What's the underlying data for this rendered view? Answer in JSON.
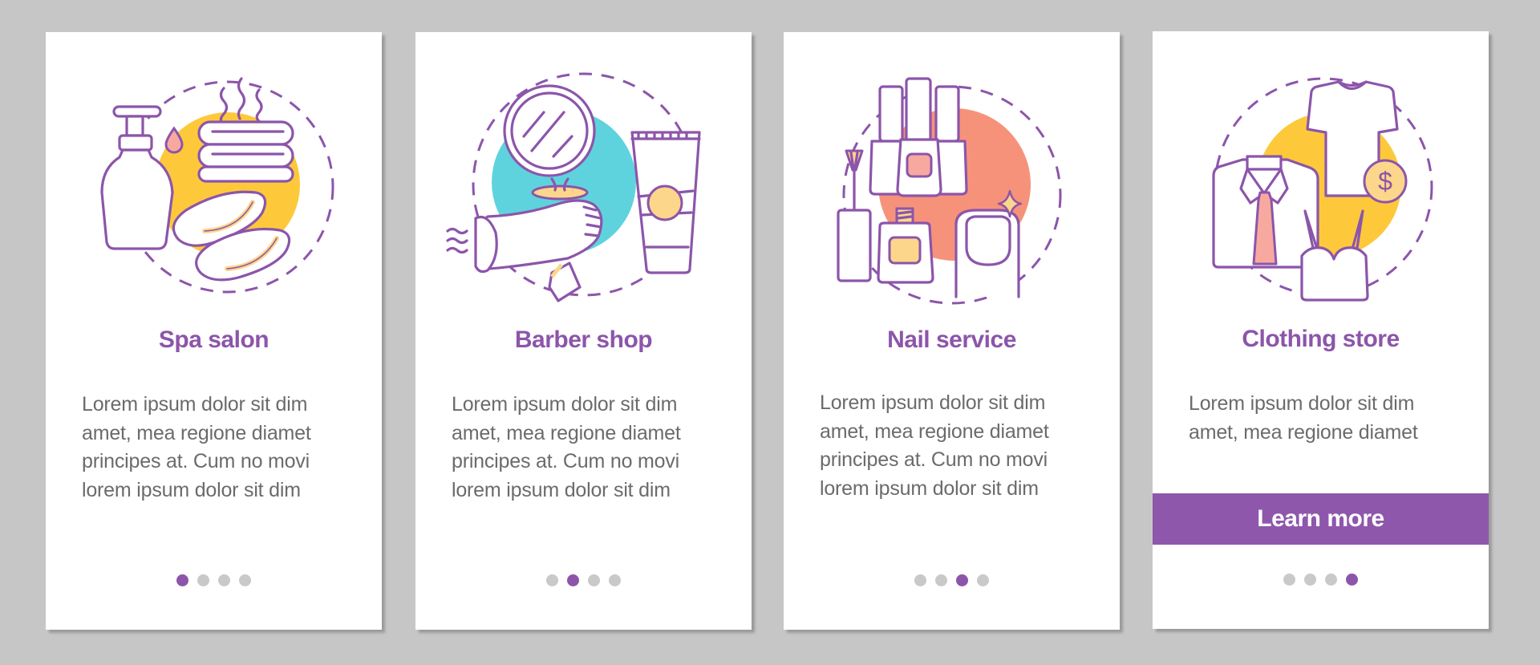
{
  "colors": {
    "accent": "#8c55aa",
    "button": "#8f57ac",
    "body_text": "#6b6b6b",
    "dot_inactive": "#c9c9c9",
    "background": "#c6c6c6",
    "yellow": "#fdc93b",
    "teal": "#5fd3dd",
    "salmon": "#f7927a",
    "light_orange": "#fcd68a",
    "pink": "#f7a9a0"
  },
  "cards": [
    {
      "title": "Spa salon",
      "icon": "spa-salon-illustration",
      "body": [
        "Lorem ipsum dolor sit dim",
        "amet, mea regione diamet",
        "principes at. Cum no movi",
        "lorem ipsum dolor sit dim"
      ],
      "page_indicator": {
        "total": 4,
        "active": 1
      }
    },
    {
      "title": "Barber shop",
      "icon": "barber-shop-illustration",
      "body": [
        "Lorem ipsum dolor sit dim",
        "amet, mea regione diamet",
        "principes at. Cum no movi",
        "lorem ipsum dolor sit dim"
      ],
      "page_indicator": {
        "total": 4,
        "active": 2
      }
    },
    {
      "title": "Nail service",
      "icon": "nail-service-illustration",
      "body": [
        "Lorem ipsum dolor sit dim",
        "amet, mea regione diamet",
        "principes at. Cum no movi",
        "lorem ipsum dolor sit dim"
      ],
      "page_indicator": {
        "total": 4,
        "active": 3
      }
    },
    {
      "title": "Clothing store",
      "icon": "clothing-store-illustration",
      "body": [
        "Lorem ipsum dolor sit dim",
        "amet, mea regione diamet"
      ],
      "button_label": "Learn more",
      "currency_symbol": "$",
      "page_indicator": {
        "total": 4,
        "active": 4
      }
    }
  ]
}
